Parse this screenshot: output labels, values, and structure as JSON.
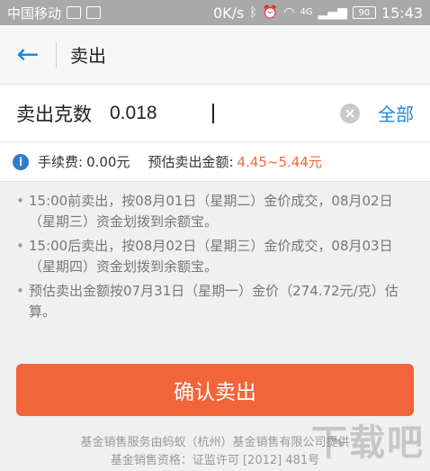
{
  "status_bar": {
    "carrier": "中国移动",
    "network_speed": "0K/s",
    "network_type": "4G",
    "battery": "90",
    "time": "15:43",
    "icons": [
      "notification-icon",
      "image-icon",
      "bluetooth-icon",
      "alarm-icon",
      "wifi-icon",
      "signal-icon",
      "battery-icon"
    ]
  },
  "header": {
    "back_icon": "arrow-left-icon",
    "title": "卖出"
  },
  "sell_form": {
    "label": "卖出克数",
    "value": "0.018",
    "clear_icon": "clear-icon",
    "all_label": "全部"
  },
  "fee": {
    "info_icon": "info-icon",
    "fee_label": "手续费:",
    "fee_value": "0.00元",
    "estimate_label": "预估卖出金额:",
    "estimate_value": "4.45~5.44元"
  },
  "notes": [
    "15:00前卖出，按08月01日（星期二）金价成交，08月02日（星期三）资金划拨到余额宝。",
    "15:00后卖出，按08月02日（星期三）金价成交，08月03日（星期四）资金划拨到余额宝。",
    "预估卖出金额按07月31日（星期一）金价（274.72元/克）估算。"
  ],
  "confirm_button": "确认卖出",
  "footer": {
    "line1": "基金销售服务由蚂蚁（杭州）基金销售有限公司提供",
    "line2": "基金销售资格：证监许可 [2012] 481号"
  },
  "watermark": "下载吧",
  "colors": {
    "accent_blue": "#1e88e5",
    "button_orange": "#f2653b",
    "estimate_orange": "#f26b3a"
  }
}
